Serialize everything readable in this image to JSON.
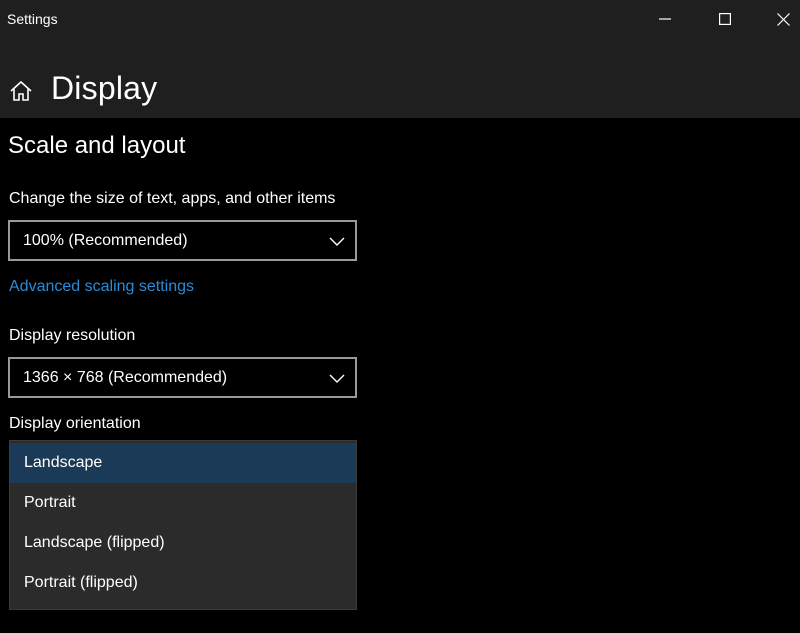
{
  "window": {
    "title": "Settings"
  },
  "header": {
    "title": "Display"
  },
  "scale_layout": {
    "section_title": "Scale and layout",
    "size_label": "Change the size of text, apps, and other items",
    "size_value": "100% (Recommended)",
    "advanced_link": "Advanced scaling settings",
    "resolution_label": "Display resolution",
    "resolution_value": "1366 × 768 (Recommended)",
    "orientation_label": "Display orientation",
    "orientation_options": [
      {
        "label": "Landscape",
        "selected": true
      },
      {
        "label": "Portrait",
        "selected": false
      },
      {
        "label": "Landscape (flipped)",
        "selected": false
      },
      {
        "label": "Portrait (flipped)",
        "selected": false
      }
    ]
  },
  "colors": {
    "background": "#000000",
    "header_band": "#1f1f1f",
    "link": "#2b8ad6",
    "selected_option": "#1b3a57",
    "dropdown_bg": "#2b2b2b"
  },
  "icons": {
    "home": "home-icon",
    "minimize": "minimize-icon",
    "maximize": "maximize-icon",
    "close": "close-icon",
    "chevron": "chevron-down-icon"
  }
}
